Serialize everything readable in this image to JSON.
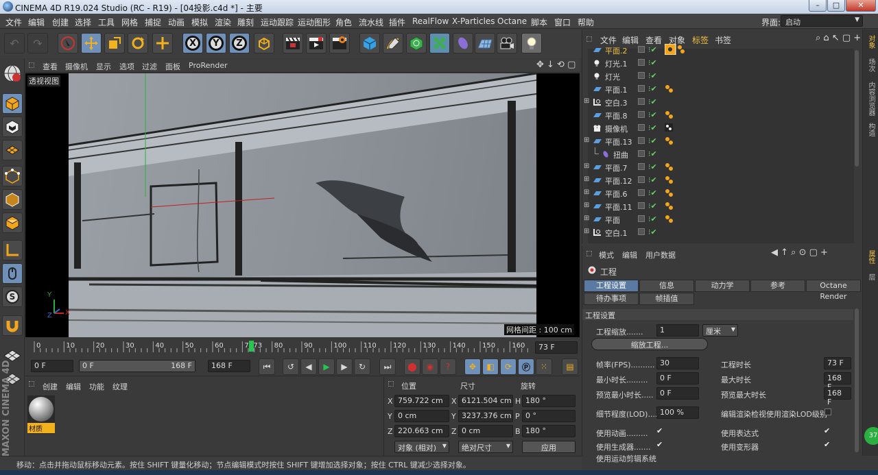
{
  "window": {
    "title": "CINEMA 4D R19.024 Studio (RC - R19) - [04投影.c4d *] - 主要",
    "min": "–",
    "max": "□",
    "close": "✕"
  },
  "menu": {
    "items": [
      "文件",
      "编辑",
      "创建",
      "选择",
      "工具",
      "网格",
      "捕捉",
      "动画",
      "模拟",
      "渲染",
      "雕刻",
      "运动跟踪",
      "运动图形",
      "角色",
      "流水线",
      "插件",
      "RealFlow",
      "X-Particles",
      "Octane",
      "脚本",
      "窗口",
      "帮助"
    ],
    "layout_label": "界面:",
    "layout_value": "启动"
  },
  "toolbar": {
    "x": "X",
    "y": "Y",
    "z": "Z"
  },
  "viewport": {
    "menu": [
      "查看",
      "摄像机",
      "显示",
      "选项",
      "过滤",
      "面板",
      "ProRender"
    ],
    "label": "透视视图",
    "grid_label": "网格间距 : 100 cm",
    "axis_y": "Y",
    "axis_x": "X",
    "axis_z": "Z"
  },
  "timeline": {
    "ticks": [
      "0",
      "10",
      "20",
      "30",
      "40",
      "50",
      "60",
      "70",
      "73",
      "80",
      "90",
      "100",
      "110",
      "120",
      "130",
      "140",
      "150",
      "160"
    ],
    "current": 73,
    "max": 168,
    "end_field": "73 F"
  },
  "playback": {
    "start": "0 F",
    "range_start": "0 F",
    "range_end": "168 F",
    "end": "168 F"
  },
  "materials": {
    "menu": [
      "创建",
      "编辑",
      "功能",
      "纹理"
    ],
    "item": "材质"
  },
  "coords": {
    "headers": [
      "位置",
      "尺寸",
      "旋转"
    ],
    "rows": [
      {
        "a": "X",
        "pos": "759.722 cm",
        "b": "X",
        "size": "6121.504 cm",
        "c": "H",
        "rot": "180 °"
      },
      {
        "a": "Y",
        "pos": "0 cm",
        "b": "Y",
        "size": "3237.376 cm",
        "c": "P",
        "rot": "0 °"
      },
      {
        "a": "Z",
        "pos": "220.663 cm",
        "b": "Z",
        "size": "0 cm",
        "c": "B",
        "rot": "180 °"
      }
    ],
    "mode1": "对象 (相对)",
    "mode2": "绝对尺寸",
    "apply": "应用"
  },
  "status": "移动：点击并拖动鼠标移动元素。按住 SHIFT 键量化移动；节点编辑模式时按住 SHIFT 键增加选择对象；按住 CTRL 键减少选择对象。",
  "objects": {
    "menu": [
      "文件",
      "编辑",
      "查看",
      "对象",
      "标签",
      "书签"
    ],
    "rows": [
      {
        "name": "平面.2",
        "type": "plane",
        "sel": true,
        "tag": true
      },
      {
        "name": "灯光.1",
        "type": "light"
      },
      {
        "name": "灯光",
        "type": "light"
      },
      {
        "name": "平面.1",
        "type": "plane",
        "tag": true
      },
      {
        "name": "空白.3",
        "type": "null",
        "exp": true
      },
      {
        "name": "平面.8",
        "type": "plane",
        "tag": true
      },
      {
        "name": "摄像机",
        "type": "camera"
      },
      {
        "name": "平面.13",
        "type": "plane",
        "exp": true,
        "tag": true
      },
      {
        "name": "扭曲",
        "type": "bend",
        "child": true
      },
      {
        "name": "平面.7",
        "type": "plane",
        "exp": true,
        "tag": true
      },
      {
        "name": "平面.12",
        "type": "plane",
        "exp": true,
        "tag": true
      },
      {
        "name": "平面.6",
        "type": "plane",
        "exp": true,
        "tag": true
      },
      {
        "name": "平面.11",
        "type": "plane",
        "exp": true,
        "tag": true
      },
      {
        "name": "平面",
        "type": "plane",
        "exp": true,
        "tag": true
      },
      {
        "name": "空白.1",
        "type": "null",
        "exp": true
      }
    ]
  },
  "attributes": {
    "menu": [
      "模式",
      "编辑",
      "用户数据"
    ],
    "object": "工程",
    "tabs": [
      "工程设置",
      "信息",
      "动力学",
      "参考",
      "Octane Render"
    ],
    "tabs2": [
      "待办事项",
      "帧插值"
    ],
    "section": "工程设置",
    "scale_label": "工程缩放.......",
    "scale_value": "1",
    "scale_unit": "厘米",
    "scale_btn": "缩放工程...",
    "fields": [
      {
        "label": "帧率(FPS)..........",
        "value": "30",
        "label2": "工程时长",
        "value2": "73 F"
      },
      {
        "label": "最小时长.........",
        "value": "0 F",
        "label2": "最大时长",
        "value2": "168 F"
      },
      {
        "label": "预览最小时长.....",
        "value": "0 F",
        "label2": "预览最大时长",
        "value2": "168 F"
      }
    ],
    "lod_label": "细节程度(LOD)....",
    "lod_value": "100 %",
    "lod_check": "编辑渲染检视使用渲染LOD级别",
    "checks": [
      {
        "l": "使用动画.........",
        "r": "使用表达式"
      },
      {
        "l": "使用生成器.......",
        "r": "使用变形器"
      },
      {
        "l": "使用运动剪辑系统",
        "r": ""
      }
    ]
  },
  "side_tabs": [
    "对象",
    "场次",
    "内容浏览器",
    "构造"
  ],
  "side_tabs2": [
    "属性",
    "层"
  ],
  "brand": "MAXON CINEMA 4D",
  "badge": "37"
}
